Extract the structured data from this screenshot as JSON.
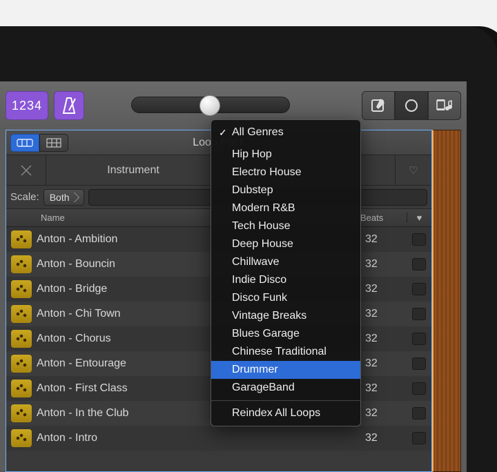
{
  "toolbar": {
    "counter": "1234"
  },
  "panel": {
    "title": "Loop Pack",
    "filter_tab_instrument": "Instrument",
    "scale_label": "Scale:",
    "scale_value": "Both",
    "header_name": "Name",
    "header_beats": "Beats"
  },
  "rows": [
    {
      "name": "Anton - Ambition",
      "beats": "32"
    },
    {
      "name": "Anton - Bouncin",
      "beats": "32"
    },
    {
      "name": "Anton - Bridge",
      "beats": "32"
    },
    {
      "name": "Anton - Chi Town",
      "beats": "32"
    },
    {
      "name": "Anton - Chorus",
      "beats": "32"
    },
    {
      "name": "Anton - Entourage",
      "beats": "32"
    },
    {
      "name": "Anton - First Class",
      "beats": "32"
    },
    {
      "name": "Anton - In the Club",
      "beats": "32"
    },
    {
      "name": "Anton - Intro",
      "beats": "32"
    }
  ],
  "menu": {
    "items": [
      "All Genres",
      "Hip Hop",
      "Electro House",
      "Dubstep",
      "Modern R&B",
      "Tech House",
      "Deep House",
      "Chillwave",
      "Indie Disco",
      "Disco Funk",
      "Vintage Breaks",
      "Blues Garage",
      "Chinese Traditional",
      "Drummer",
      "GarageBand"
    ],
    "checked_index": 0,
    "selected_index": 13,
    "footer": "Reindex All Loops"
  }
}
